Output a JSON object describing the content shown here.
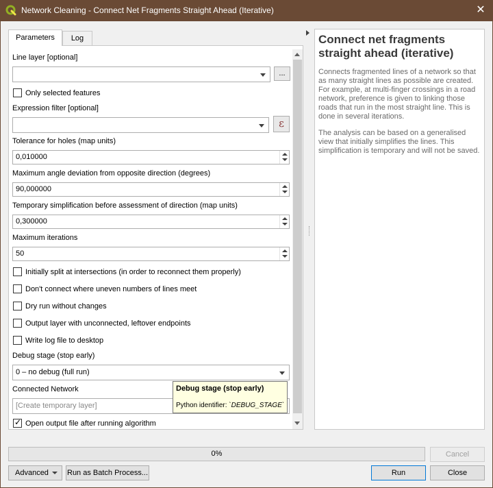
{
  "window": {
    "title": "Network Cleaning - Connect Net Fragments Straight Ahead (Iterative)",
    "app_icon": "qgis-logo",
    "close_glyph": "✕"
  },
  "tabs": [
    {
      "label": "Parameters",
      "active": true
    },
    {
      "label": "Log",
      "active": false
    }
  ],
  "params": {
    "line_layer_label": "Line layer [optional]",
    "line_layer_value": "",
    "browse_label": "...",
    "only_selected_label": "Only selected features",
    "only_selected_checked": false,
    "expression_label": "Expression filter [optional]",
    "expression_value": "",
    "expression_button_glyph": "ε",
    "tolerance_label": "Tolerance for holes (map units)",
    "tolerance_value": "0,010000",
    "max_angle_label": "Maximum angle deviation from opposite direction (degrees)",
    "max_angle_value": "90,000000",
    "simplification_label": "Temporary simplification before assessment of direction (map units)",
    "simplification_value": "0,300000",
    "iterations_label": "Maximum iterations",
    "iterations_value": "50",
    "checkboxes": [
      {
        "label": "Initially split at intersections (in order to reconnect them properly)",
        "checked": false
      },
      {
        "label": "Don't connect where uneven numbers of lines meet",
        "checked": false
      },
      {
        "label": "Dry run without changes",
        "checked": false
      },
      {
        "label": "Output layer with unconnected, leftover endpoints",
        "checked": false
      },
      {
        "label": "Write log file to desktop",
        "checked": false
      }
    ],
    "debug_label": "Debug stage (stop early)",
    "debug_value": "0 – no debug (full run)",
    "connected_label": "Connected Network",
    "connected_placeholder": "[Create temporary layer]",
    "open_output_label": "Open output file after running algorithm",
    "open_output_checked": true
  },
  "tooltip": {
    "title": "Debug stage (stop early)",
    "body_prefix": "Python identifier: ",
    "identifier": "`DEBUG_STAGE`"
  },
  "help": {
    "title": "Connect net fragments straight ahead (iterative)",
    "paragraphs": [
      "Connects fragmented lines of a network so that as many straight lines as possible are created. For example, at multi-finger crossings in a road network, preference is given to linking those roads that run in the most straight line. This is done in several iterations.",
      "The analysis can be based on a generalised view that initially simplifies the lines. This simplification is temporary and will not be saved."
    ]
  },
  "footer": {
    "progress_text": "0%",
    "progress_fraction": 0,
    "cancel_label": "Cancel",
    "advanced_label": "Advanced",
    "batch_label": "Run as Batch Process...",
    "run_label": "Run",
    "close_label": "Close"
  },
  "colors": {
    "titlebar": "#6a4a35",
    "qgis_green": "#93b023",
    "qgis_yellow": "#f0e64a",
    "focus_blue": "#0078d7"
  }
}
